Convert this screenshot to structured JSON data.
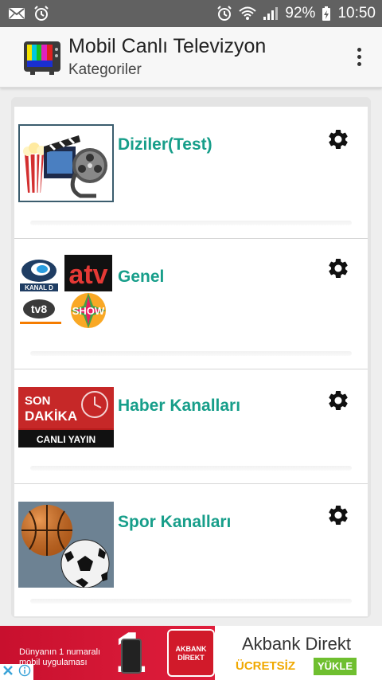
{
  "status_bar": {
    "battery": "92%",
    "time": "10:50"
  },
  "app_bar": {
    "title": "Mobil Canlı Televizyon",
    "subtitle": "Kategoriler"
  },
  "categories": [
    {
      "label": "Diziler(Test)"
    },
    {
      "label": "Genel",
      "logos": [
        "KANAL D",
        "atv",
        "SHOW"
      ]
    },
    {
      "label": "Haber Kanalları",
      "thumb_text": [
        "SON",
        "DAKİKA",
        "CANLI YAYIN"
      ]
    },
    {
      "label": "Spor Kanalları"
    }
  ],
  "ad": {
    "tagline": "Dünyanın 1 numaralı mobil uygulaması",
    "big_number": "1",
    "logo_text": "AKBANK DİREKT",
    "brand": "Akbank Direkt",
    "free_text": "ÜCRETSİZ",
    "button": "YÜKLE"
  },
  "colors": {
    "accent": "#179e8a",
    "status_bar": "#616161",
    "ad_red": "#c8102e"
  }
}
